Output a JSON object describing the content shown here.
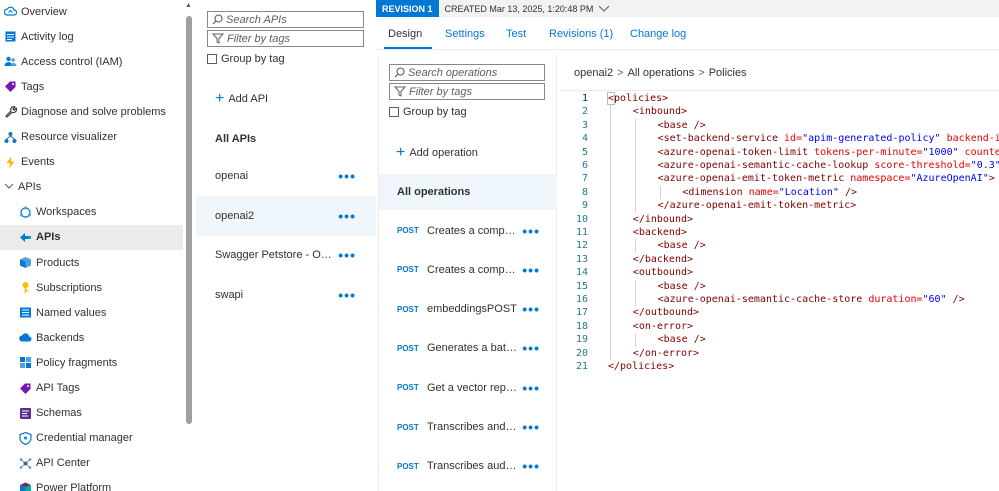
{
  "nav": {
    "items": [
      {
        "label": "Overview",
        "icon": "cloud-icon",
        "level": "top"
      },
      {
        "label": "Activity log",
        "icon": "activity-log-icon",
        "level": "top"
      },
      {
        "label": "Access control (IAM)",
        "icon": "people-icon",
        "level": "top"
      },
      {
        "label": "Tags",
        "icon": "tag-icon",
        "level": "top"
      },
      {
        "label": "Diagnose and solve problems",
        "icon": "wrench-icon",
        "level": "top"
      },
      {
        "label": "Resource visualizer",
        "icon": "visualizer-icon",
        "level": "top"
      },
      {
        "label": "Events",
        "icon": "lightning-icon",
        "level": "top"
      },
      {
        "label": "APIs",
        "icon": "chevron-down-icon",
        "level": "group"
      },
      {
        "label": "Workspaces",
        "icon": "workspaces-icon",
        "level": "sub"
      },
      {
        "label": "APIs",
        "icon": "api-arrow-icon",
        "level": "sub",
        "active": true
      },
      {
        "label": "Products",
        "icon": "products-icon",
        "level": "sub"
      },
      {
        "label": "Subscriptions",
        "icon": "key-icon",
        "level": "sub"
      },
      {
        "label": "Named values",
        "icon": "list-icon",
        "level": "sub"
      },
      {
        "label": "Backends",
        "icon": "backends-cloud-icon",
        "level": "sub"
      },
      {
        "label": "Policy fragments",
        "icon": "policy-fragments-icon",
        "level": "sub"
      },
      {
        "label": "API Tags",
        "icon": "api-tag-icon",
        "level": "sub"
      },
      {
        "label": "Schemas",
        "icon": "schemas-icon",
        "level": "sub"
      },
      {
        "label": "Credential manager",
        "icon": "credential-shield-icon",
        "level": "sub"
      },
      {
        "label": "API Center",
        "icon": "api-center-icon",
        "level": "sub"
      },
      {
        "label": "Power Platform",
        "icon": "power-platform-icon",
        "level": "sub"
      }
    ]
  },
  "apis": {
    "search_placeholder": "Search APIs",
    "filter_placeholder": "Filter by tags",
    "group_by_tag": "Group by tag",
    "add_api": "Add API",
    "heading": "All APIs",
    "list": [
      {
        "label": "openai",
        "active": false
      },
      {
        "label": "openai2",
        "active": true
      },
      {
        "label": "Swagger Petstore - Ope...",
        "active": false
      },
      {
        "label": "swapi",
        "active": false
      }
    ]
  },
  "revision": {
    "badge": "REVISION 1",
    "created": "CREATED Mar 13, 2025, 1:20:48 PM"
  },
  "tabs": [
    {
      "label": "Design",
      "active": true
    },
    {
      "label": "Settings",
      "active": false
    },
    {
      "label": "Test",
      "active": false
    },
    {
      "label": "Revisions (1)",
      "active": false
    },
    {
      "label": "Change log",
      "active": false
    }
  ],
  "operations": {
    "search_placeholder": "Search operations",
    "filter_placeholder": "Filter by tags",
    "group_by_tag": "Group by tag",
    "add_operation": "Add operation",
    "heading": "All operations",
    "list": [
      {
        "method": "POST",
        "label": "Creates a comple..."
      },
      {
        "method": "POST",
        "label": "Creates a comple..."
      },
      {
        "method": "POST",
        "label": "embeddingsPOST"
      },
      {
        "method": "POST",
        "label": "Generates a batc..."
      },
      {
        "method": "POST",
        "label": "Get a vector repr..."
      },
      {
        "method": "POST",
        "label": "Transcribes and tr..."
      },
      {
        "method": "POST",
        "label": "Transcribes audio..."
      }
    ]
  },
  "breadcrumb": [
    "openai2",
    "All operations",
    "Policies"
  ],
  "code": {
    "line_numbers": [
      "1",
      "2",
      "3",
      "4",
      "5",
      "6",
      "7",
      "8",
      "9",
      "10",
      "11",
      "12",
      "13",
      "14",
      "15",
      "16",
      "17",
      "18",
      "19",
      "20",
      "21"
    ],
    "lines": [
      {
        "indent": 0,
        "tag": "<policies>"
      },
      {
        "indent": 1,
        "tag": "<inbound>"
      },
      {
        "indent": 2,
        "tag": "<base />"
      },
      {
        "indent": 2,
        "tag": "<set-backend-service",
        "attr": " id=",
        "val": "\"apim-generated-policy\"",
        "attr2": " backend-i"
      },
      {
        "indent": 2,
        "tag": "<azure-openai-token-limit",
        "attr": " tokens-per-minute=",
        "val": "\"1000\"",
        "attr2": " counte"
      },
      {
        "indent": 2,
        "tag": "<azure-openai-semantic-cache-lookup",
        "attr": " score-threshold=",
        "val": "\"0.3\""
      },
      {
        "indent": 2,
        "tag": "<azure-openai-emit-token-metric",
        "attr": " namespace=",
        "val": "\"AzureOpenAI\"",
        "tail": ">"
      },
      {
        "indent": 3,
        "tag": "<dimension",
        "attr": " name=",
        "val": "\"Location\"",
        "tail": " />"
      },
      {
        "indent": 2,
        "tag": "</azure-openai-emit-token-metric>"
      },
      {
        "indent": 1,
        "tag": "</inbound>"
      },
      {
        "indent": 1,
        "tag": "<backend>"
      },
      {
        "indent": 2,
        "tag": "<base />"
      },
      {
        "indent": 1,
        "tag": "</backend>"
      },
      {
        "indent": 1,
        "tag": "<outbound>"
      },
      {
        "indent": 2,
        "tag": "<base />"
      },
      {
        "indent": 2,
        "tag": "<azure-openai-semantic-cache-store",
        "attr": " duration=",
        "val": "\"60\"",
        "tail": " />"
      },
      {
        "indent": 1,
        "tag": "</outbound>"
      },
      {
        "indent": 1,
        "tag": "<on-error>"
      },
      {
        "indent": 2,
        "tag": "<base />"
      },
      {
        "indent": 1,
        "tag": "</on-error>"
      },
      {
        "indent": 0,
        "tag": "</policies>"
      }
    ]
  },
  "colors": {
    "accent": "#0078d4",
    "selected_bg": "#eff6fc",
    "nav_active_bg": "#edebe9"
  }
}
